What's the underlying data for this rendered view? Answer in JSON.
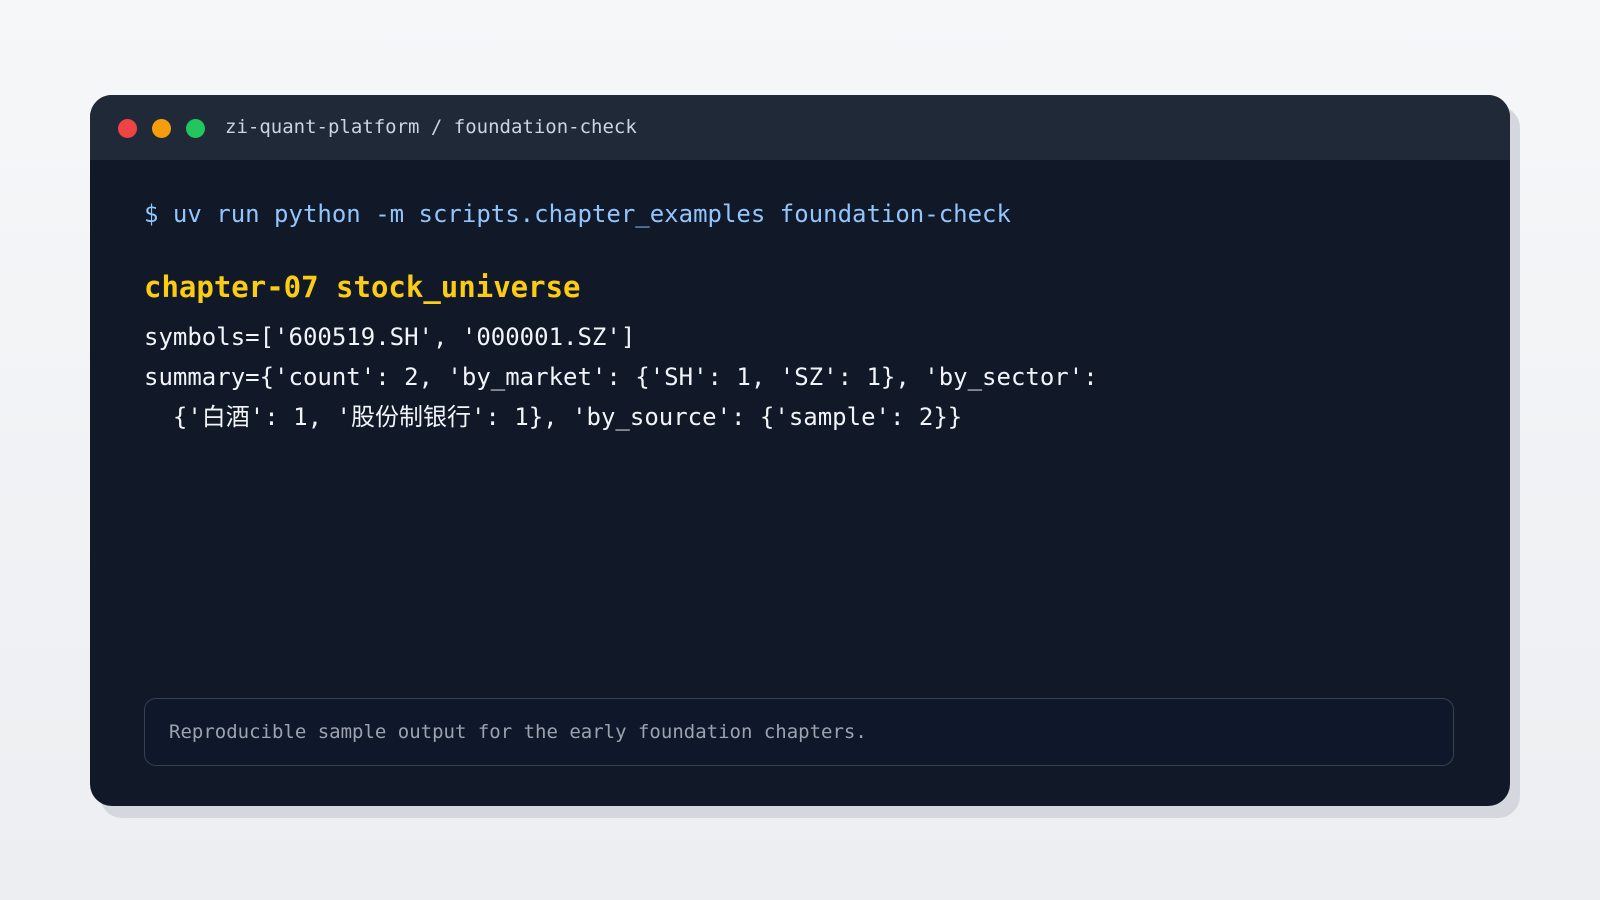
{
  "window": {
    "title": "zi-quant-platform / foundation-check",
    "controls": {
      "close_color": "#ef4444",
      "minimize_color": "#f59e0b",
      "maximize_color": "#22c55e"
    }
  },
  "terminal": {
    "command": "$ uv run python -m scripts.chapter_examples foundation-check",
    "heading": "chapter-07 stock_universe",
    "output_lines": [
      "symbols=['600519.SH', '000001.SZ']",
      "summary={'count': 2, 'by_market': {'SH': 1, 'SZ': 1}, 'by_sector':",
      "  {'白酒': 1, '股份制银行': 1}, 'by_source': {'sample': 2}}"
    ]
  },
  "footer_note": "Reproducible sample output for the early foundation chapters.",
  "colors": {
    "background": "#f3f5f7",
    "window_body": "#111827",
    "titlebar": "#1f2937",
    "command": "#93c5fd",
    "heading": "#facc15",
    "output": "#f1f5f9",
    "note_text": "#9ca3af"
  }
}
